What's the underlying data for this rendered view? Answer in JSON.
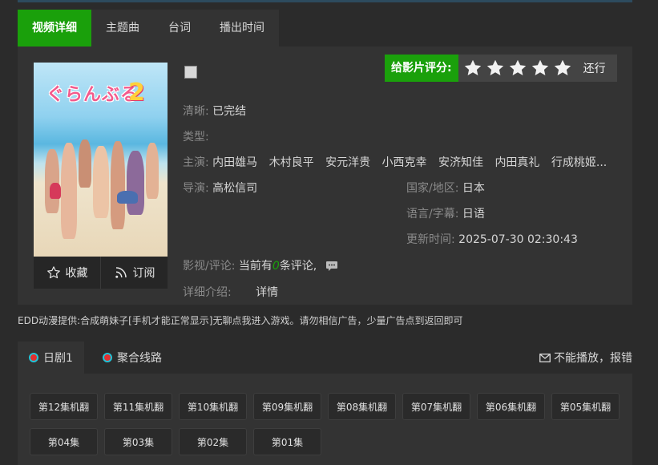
{
  "tabs": [
    "视频详细",
    "主题曲",
    "台词",
    "播出时间"
  ],
  "poster": {
    "logo": "ぐらんぶる",
    "number": "2"
  },
  "actions": {
    "favorite": "收藏",
    "subscribe": "订阅"
  },
  "rating": {
    "label": "给影片评分:",
    "stars": 5,
    "text": "还行"
  },
  "details": {
    "clarity_label": "清晰:",
    "clarity": "已完结",
    "type_label": "类型:",
    "type": "",
    "cast_label": "主演:",
    "cast": [
      "内田雄马",
      "木村良平",
      "安元洋贵",
      "小西克幸",
      "安济知佳",
      "内田真礼",
      "行成桃姬..."
    ],
    "director_label": "导演:",
    "director": "高松信司",
    "region_label": "国家/地区:",
    "region": "日本",
    "language_label": "语言/字幕:",
    "language": "日语",
    "updated_label": "更新时间:",
    "updated": "2025-07-30 02:30:43",
    "comment_label": "影视/评论:",
    "comment_prefix": "当前有",
    "comment_count": "0",
    "comment_suffix": "条评论,",
    "intro_label": "详细介绍:",
    "intro_link": "详情"
  },
  "notice": "EDD动漫提供:合成萌妹子[手机才能正常显示]无聊点我进入游戏。请勿相信广告，少量广告点到返回即可",
  "lines": [
    "日剧1",
    "聚合线路"
  ],
  "report": "不能播放，报错",
  "episodes": [
    "第12集机翻",
    "第11集机翻",
    "第10集机翻",
    "第09集机翻",
    "第08集机翻",
    "第07集机翻",
    "第06集机翻",
    "第05集机翻",
    "第04集",
    "第03集",
    "第02集",
    "第01集"
  ],
  "colors": {
    "accent": "#1aa00b",
    "background": "#2b2b2b",
    "panel": "#333333"
  }
}
